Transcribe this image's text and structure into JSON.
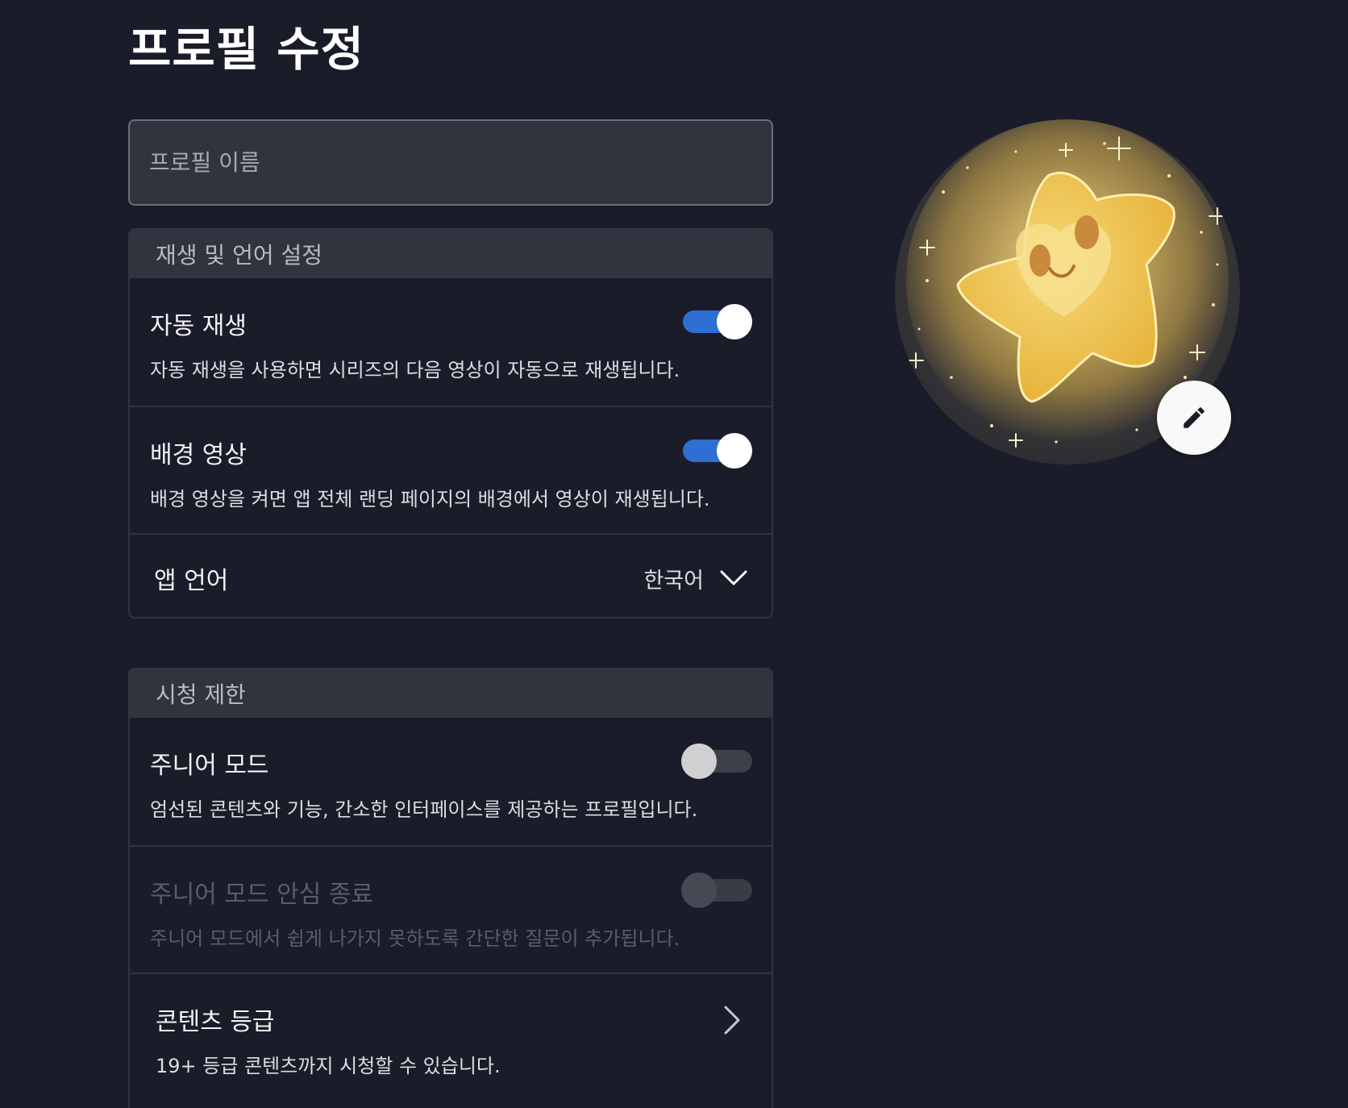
{
  "page": {
    "title": "프로필 수정"
  },
  "profile_name": {
    "placeholder": "프로필 이름",
    "value": ""
  },
  "playback": {
    "header": "재생 및 언어 설정",
    "autoplay": {
      "title": "자동 재생",
      "description": "자동 재생을 사용하면 시리즈의 다음 영상이 자동으로 재생됩니다.",
      "enabled": true
    },
    "background_video": {
      "title": "배경 영상",
      "description": "배경 영상을 켜면 앱 전체 랜딩 페이지의 배경에서 영상이 재생됩니다.",
      "enabled": true
    },
    "app_language": {
      "label": "앱 언어",
      "value": "한국어",
      "icon": "chevron-down-icon"
    }
  },
  "parental": {
    "header": "시청 제한",
    "junior_mode": {
      "title": "주니어 모드",
      "description": "엄선된 콘텐츠와 기능, 간소한 인터페이스를 제공하는 프로필입니다.",
      "enabled": false
    },
    "junior_exit_lock": {
      "title": "주니어 모드 안심 종료",
      "description": "주니어 모드에서 쉽게 나가지 못하도록 간단한 질문이 추가됩니다.",
      "enabled": false,
      "disabled": true
    },
    "content_rating": {
      "title": "콘텐츠 등급",
      "description": "19+ 등급 콘텐츠까지 시청할 수 있습니다.",
      "icon": "chevron-right-icon"
    }
  },
  "avatar": {
    "icon": "pencil-icon"
  },
  "colors": {
    "background": "#1a1c29",
    "panel_header": "#31343e",
    "toggle_on": "#2f6fd3",
    "toggle_off": "#3e4049"
  }
}
